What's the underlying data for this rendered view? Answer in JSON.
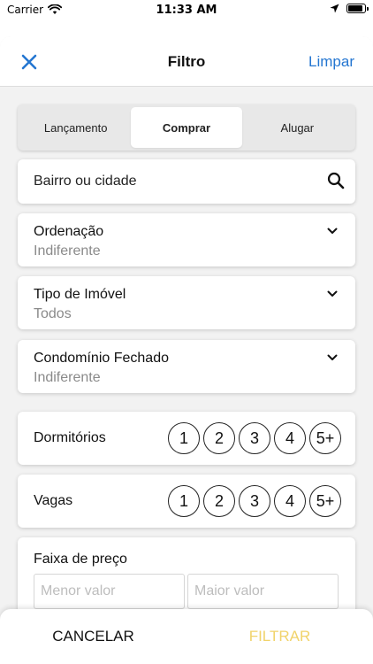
{
  "status_bar": {
    "carrier": "Carrier",
    "time": "11:33 AM"
  },
  "nav": {
    "close_icon": "close-icon",
    "title": "Filtro",
    "clear_label": "Limpar"
  },
  "tabs": [
    {
      "label": "Lançamento",
      "active": false
    },
    {
      "label": "Comprar",
      "active": true
    },
    {
      "label": "Alugar",
      "active": false
    }
  ],
  "search": {
    "placeholder": "Bairro ou cidade",
    "icon": "search-icon"
  },
  "selects": [
    {
      "label": "Ordenação",
      "value": "Indiferente"
    },
    {
      "label": "Tipo de Imóvel",
      "value": "Todos"
    },
    {
      "label": "Condomínio Fechado",
      "value": "Indiferente"
    }
  ],
  "bedrooms": {
    "label": "Dormitórios",
    "options": [
      "1",
      "2",
      "3",
      "4",
      "5+"
    ]
  },
  "parking": {
    "label": "Vagas",
    "options": [
      "1",
      "2",
      "3",
      "4",
      "5+"
    ]
  },
  "price": {
    "label": "Faixa de preço",
    "min_placeholder": "Menor valor",
    "max_placeholder": "Maior valor"
  },
  "actions": {
    "cancel_label": "CANCELAR",
    "filter_label": "FILTRAR"
  },
  "colors": {
    "accent": "#2476d1",
    "filter": "#f1d36a"
  }
}
